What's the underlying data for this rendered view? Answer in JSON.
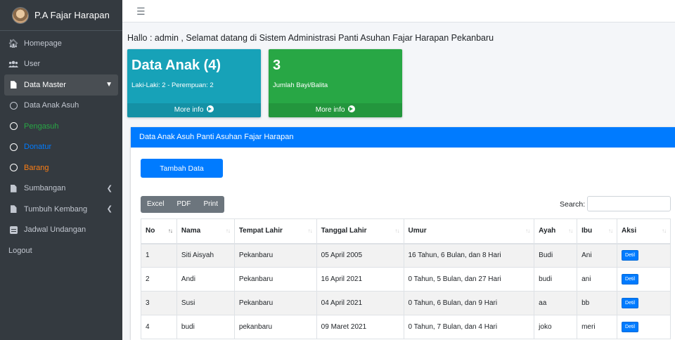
{
  "brand": {
    "title": "P.A Fajar Harapan"
  },
  "sidebar": {
    "items": [
      {
        "label": "Homepage",
        "icon": "home-icon"
      },
      {
        "label": "User",
        "icon": "users-icon"
      },
      {
        "label": "Data Master",
        "icon": "file-icon",
        "active": true
      },
      {
        "label": "Data Anak Asuh",
        "icon": "circle-icon"
      },
      {
        "label": "Pengasuh",
        "icon": "circle-icon",
        "color": "#28a745"
      },
      {
        "label": "Donatur",
        "icon": "circle-icon",
        "color": "#007bff"
      },
      {
        "label": "Barang",
        "icon": "circle-icon",
        "color": "#fd7e14"
      },
      {
        "label": "Sumbangan",
        "icon": "file-icon"
      },
      {
        "label": "Tumbuh Kembang",
        "icon": "file-icon"
      },
      {
        "label": "Jadwal Undangan",
        "icon": "calendar-icon"
      },
      {
        "label": "Logout"
      }
    ]
  },
  "header": {
    "welcome": "Hallo : admin , Selamat datang di Sistem Administrasi Panti Asuhan Fajar Harapan Pekanbaru"
  },
  "boxes": {
    "anak": {
      "title": "Data Anak (4)",
      "desc": "Laki-Laki: 2 - Perempuan: 2",
      "footer": "More info",
      "color": "#17a2b8"
    },
    "bayi": {
      "title": "3",
      "desc": "Jumlah Bayi/Balita",
      "footer": "More info",
      "color": "#28a745"
    }
  },
  "card": {
    "title": "Data Anak Asuh Panti Asuhan Fajar Harapan",
    "add_button": "Tambah Data",
    "export": [
      "Excel",
      "PDF",
      "Print"
    ],
    "search_label": "Search:"
  },
  "table": {
    "columns": [
      "No",
      "Nama",
      "Tempat Lahir",
      "Tanggal Lahir",
      "Umur",
      "Ayah",
      "Ibu",
      "Aksi"
    ],
    "rows": [
      [
        "1",
        "Siti Aisyah",
        "Pekanbaru",
        "05 April 2005",
        "16 Tahun, 6 Bulan, dan 8 Hari",
        "Budi",
        "Ani",
        "Detil"
      ],
      [
        "2",
        "Andi",
        "Pekanbaru",
        "16 April 2021",
        "0 Tahun, 5 Bulan, dan 27 Hari",
        "budi",
        "ani",
        "Detil"
      ],
      [
        "3",
        "Susi",
        "Pekanbaru",
        "04 April 2021",
        "0 Tahun, 6 Bulan, dan 9 Hari",
        "aa",
        "bb",
        "Detil"
      ],
      [
        "4",
        "budi",
        "pekanbaru",
        "09 Maret 2021",
        "0 Tahun, 7 Bulan, dan 4 Hari",
        "joko",
        "meri",
        "Detil"
      ]
    ]
  }
}
